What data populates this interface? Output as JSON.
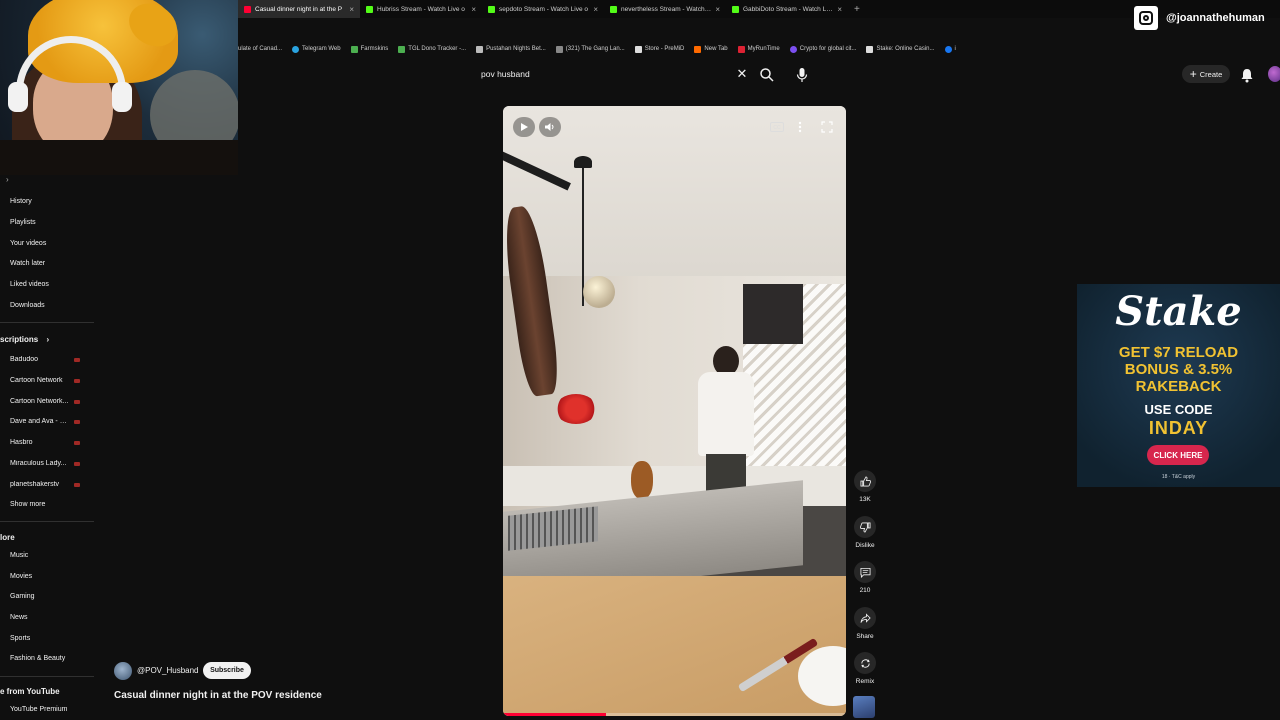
{
  "browser": {
    "tabs": [
      {
        "title": "Casual dinner night in at the P",
        "active": true,
        "color": "#ff0033"
      },
      {
        "title": "Hubriss Stream - Watch Live o",
        "active": false,
        "color": "#53fc18"
      },
      {
        "title": "sepdoto Stream - Watch Live o",
        "active": false,
        "color": "#53fc18"
      },
      {
        "title": "nevertheless Stream - Watch Li",
        "active": false,
        "color": "#53fc18"
      },
      {
        "title": "GabbiDoto Stream - Watch Live",
        "active": false,
        "color": "#53fc18"
      }
    ],
    "new_tab": "+",
    "bookmarks": [
      "ulate of Canad...",
      "Telegram Web",
      "Farmskins",
      "TGL Dono Tracker -...",
      "Pustahan Nights Bet...",
      "(321) The Gang Lan...",
      "Store - PreMiD",
      "New Tab",
      "MyRunTime",
      "Crypto for global cit...",
      "Stake: Online Casin...",
      "i"
    ]
  },
  "overlay": {
    "instagram_handle": "@joannathehuman"
  },
  "search": {
    "query": "pov husband",
    "clear_glyph": "✕"
  },
  "header": {
    "create_label": "Create",
    "create_plus": "+"
  },
  "sidebar": {
    "chevron": "›",
    "you_items": [
      "History",
      "Playlists",
      "Your videos",
      "Watch later",
      "Liked videos",
      "Downloads"
    ],
    "subscriptions_heading": "scriptions",
    "subscriptions_chevron": "›",
    "subscriptions": [
      {
        "name": "Badudoo",
        "live": true
      },
      {
        "name": "Cartoon Network",
        "live": true
      },
      {
        "name": "Cartoon Network...",
        "live": true
      },
      {
        "name": "Dave and Ava - N...",
        "live": true
      },
      {
        "name": "Hasbro",
        "live": true
      },
      {
        "name": "Miraculous Lady...",
        "live": true
      },
      {
        "name": "planetshakerstv",
        "live": true
      }
    ],
    "show_more": "Show more",
    "explore_heading": "lore",
    "explore_items": [
      "Music",
      "Movies",
      "Gaming",
      "News",
      "Sports",
      "Fashion & Beauty"
    ],
    "more_from_heading": "e from YouTube",
    "more_from_items": [
      "YouTube Premium"
    ]
  },
  "video": {
    "channel": "@POV_Husband",
    "subscribe_label": "Subscribe",
    "title": "Casual dinner night in at the POV residence",
    "progress_fraction": 0.3
  },
  "actions": {
    "like_count": "13K",
    "dislike_label": "Dislike",
    "comment_count": "210",
    "share_label": "Share",
    "remix_label": "Remix"
  },
  "ad": {
    "brand": "Stake",
    "headline_lines": [
      "GET $7 RELOAD",
      "BONUS & 3.5%",
      "RAKEBACK"
    ],
    "use_code": "USE CODE",
    "code": "INDAY",
    "cta": "CLICK HERE",
    "fine_print": "18 · T&C apply"
  },
  "colors": {
    "accent": "#ff0033",
    "ad_gold": "#f1c232",
    "ad_cta": "#d7264d",
    "kick_green": "#53fc18"
  }
}
